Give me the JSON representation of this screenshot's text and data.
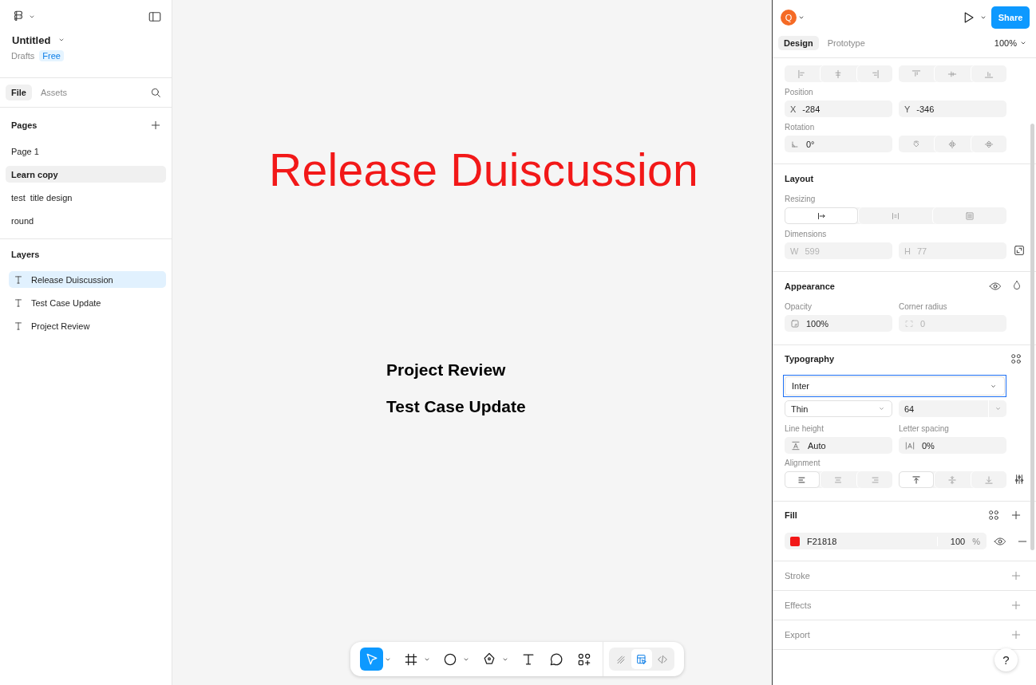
{
  "file": {
    "name": "Untitled",
    "location": "Drafts",
    "plan": "Free"
  },
  "left_tabs": [
    {
      "label": "File",
      "selected": true
    },
    {
      "label": "Assets",
      "selected": false
    }
  ],
  "pages": {
    "title": "Pages",
    "items": [
      {
        "label": "Page 1",
        "selected": false
      },
      {
        "label": "Learn copy",
        "selected": true
      },
      {
        "label": "test  title design",
        "selected": false
      },
      {
        "label": "round",
        "selected": false
      }
    ]
  },
  "layers": {
    "title": "Layers",
    "items": [
      {
        "label": "Release Duiscussion",
        "kind": "text",
        "selected": true
      },
      {
        "label": "Test Case Update",
        "kind": "text",
        "selected": false
      },
      {
        "label": "Project Review",
        "kind": "text",
        "selected": false
      }
    ]
  },
  "canvas": {
    "texts": [
      {
        "text": "Release Duiscussion",
        "kind": "heading",
        "color": "#f21818"
      },
      {
        "text": "Project Review",
        "kind": "subheading",
        "color": "#000000"
      },
      {
        "text": "Test Case Update",
        "kind": "subheading",
        "color": "#000000"
      }
    ]
  },
  "toolbar": {
    "tools": [
      {
        "kind": "move",
        "selected": true,
        "menu": true
      },
      {
        "kind": "frame",
        "selected": false,
        "menu": true
      },
      {
        "kind": "shape",
        "selected": false,
        "menu": true
      },
      {
        "kind": "pen",
        "selected": false,
        "menu": true
      },
      {
        "kind": "text",
        "selected": false,
        "menu": false
      },
      {
        "kind": "comment",
        "selected": false,
        "menu": false
      },
      {
        "kind": "actions",
        "selected": false,
        "menu": false
      }
    ],
    "modes": [
      {
        "kind": "draw",
        "selected": false
      },
      {
        "kind": "design",
        "selected": true
      },
      {
        "kind": "dev",
        "selected": false
      }
    ]
  },
  "header": {
    "avatar": "Q",
    "share": "Share"
  },
  "right_tabs": [
    {
      "label": "Design",
      "selected": true
    },
    {
      "label": "Prototype",
      "selected": false
    }
  ],
  "zoom": "100%",
  "position": {
    "label": "Position",
    "fields": [
      {
        "prefix": "X",
        "value": "-284"
      },
      {
        "prefix": "Y",
        "value": "-346"
      }
    ]
  },
  "rotation": {
    "label": "Rotation",
    "value": "0°"
  },
  "layout": {
    "title": "Layout",
    "resizing": {
      "label": "Resizing",
      "options": [
        {
          "kind": "fixed",
          "selected": true
        },
        {
          "kind": "auto-height",
          "selected": false
        },
        {
          "kind": "auto-width",
          "selected": false
        }
      ]
    },
    "dimensions": {
      "label": "Dimensions",
      "disabled": true,
      "fields": [
        {
          "prefix": "W",
          "value": "599"
        },
        {
          "prefix": "H",
          "value": "77"
        }
      ]
    }
  },
  "appearance": {
    "title": "Appearance",
    "opacity": {
      "label": "Opacity",
      "value": "100%"
    },
    "corner_radius": {
      "label": "Corner radius",
      "value": "0",
      "disabled": true
    }
  },
  "typography": {
    "title": "Typography",
    "font": {
      "value": "Inter",
      "focused": true
    },
    "weight": "Thin",
    "size": "64",
    "line_height": {
      "label": "Line height",
      "value": "Auto"
    },
    "letter_spacing": {
      "label": "Letter spacing",
      "value": "0%"
    },
    "alignment": {
      "label": "Alignment",
      "horizontal": [
        {
          "kind": "left",
          "selected": true
        },
        {
          "kind": "center",
          "selected": false
        },
        {
          "kind": "right",
          "selected": false
        }
      ],
      "vertical": [
        {
          "kind": "top",
          "selected": true
        },
        {
          "kind": "middle",
          "selected": false
        },
        {
          "kind": "bottom",
          "selected": false
        }
      ]
    }
  },
  "fill": {
    "title": "Fill",
    "items": [
      {
        "color": "#f21818",
        "hex": "F21818",
        "opacity": "100",
        "unit": "%"
      }
    ]
  },
  "sections": [
    {
      "title": "Stroke",
      "empty": true
    },
    {
      "title": "Effects",
      "empty": true
    },
    {
      "title": "Export",
      "empty": true
    }
  ],
  "help": "?"
}
